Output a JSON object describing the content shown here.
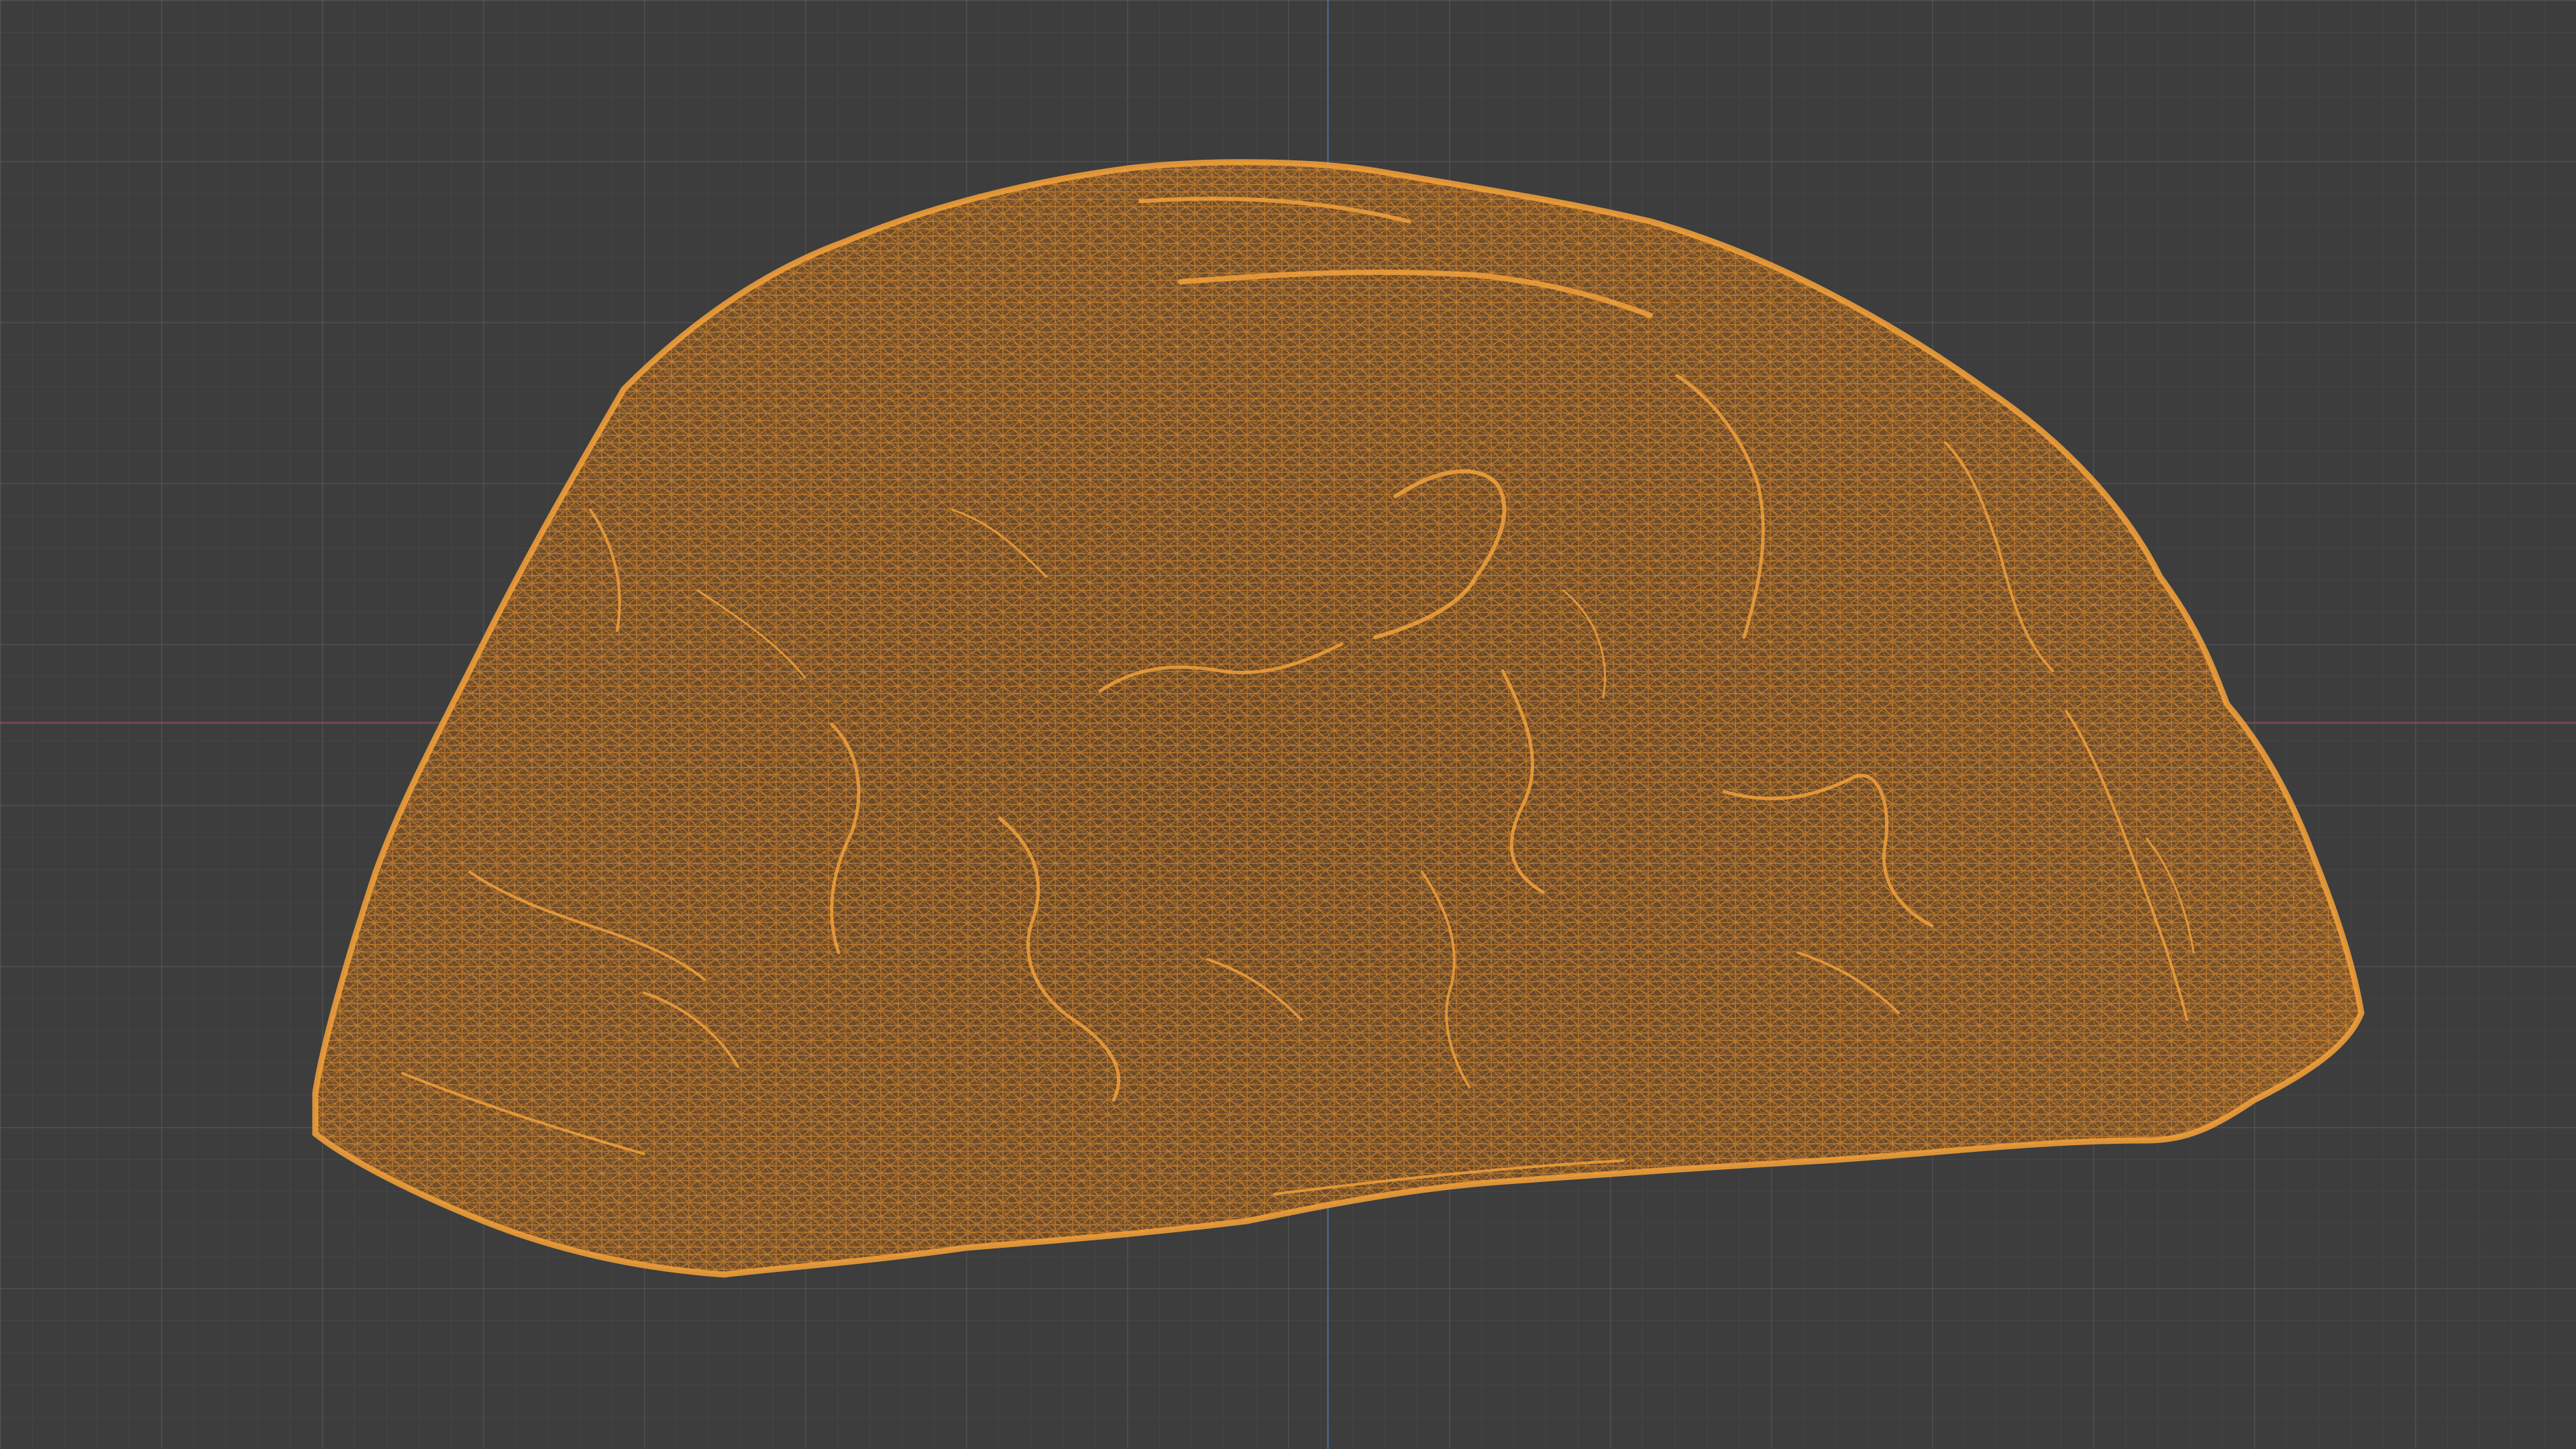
{
  "viewport": {
    "mode": "wireframe",
    "background_color": "#3d3d3d",
    "grid_visible": true,
    "x_axis_color": "#8a4a52",
    "y_axis_color": "#4a6a8f"
  },
  "object": {
    "kind": "scanned-rock-mesh",
    "selected": true,
    "wire_color": "#f0952b"
  }
}
